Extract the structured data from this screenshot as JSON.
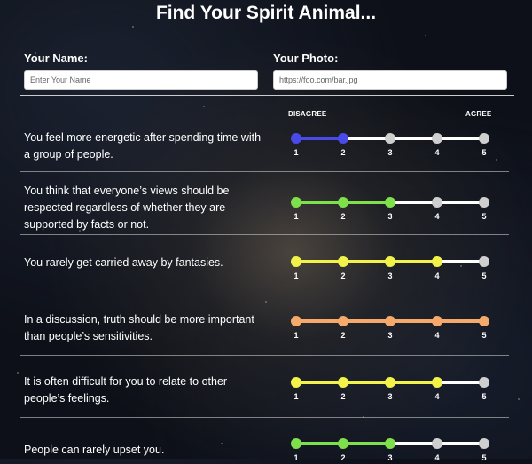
{
  "title": "Find Your Spirit Animal...",
  "name_field": {
    "label": "Your Name:",
    "placeholder": "Enter Your Name"
  },
  "photo_field": {
    "label": "Your Photo:",
    "placeholder": "https://foo.com/bar.jpg"
  },
  "scale": {
    "left_label": "DISAGREE",
    "right_label": "AGREE",
    "ticks": [
      "1",
      "2",
      "3",
      "4",
      "5"
    ]
  },
  "questions": [
    {
      "text": "You feel more energetic after spending time with a group of people.",
      "value": 2,
      "color": "#4a4ae8"
    },
    {
      "text": "You think that everyone’s views should be respected regardless of whether they are supported by facts or not.",
      "value": 3,
      "color": "#7ee04a"
    },
    {
      "text": "You rarely get carried away by fantasies.",
      "value": 4,
      "color": "#f2f24a"
    },
    {
      "text": "In a discussion, truth should be more important than people’s sensitivities.",
      "value": 5,
      "color": "#f5a96a"
    },
    {
      "text": "It is often difficult for you to relate to other people’s feelings.",
      "value": 4,
      "color": "#f2f24a"
    },
    {
      "text": "People can rarely upset you.",
      "value": 3,
      "color": "#7ee04a"
    }
  ]
}
